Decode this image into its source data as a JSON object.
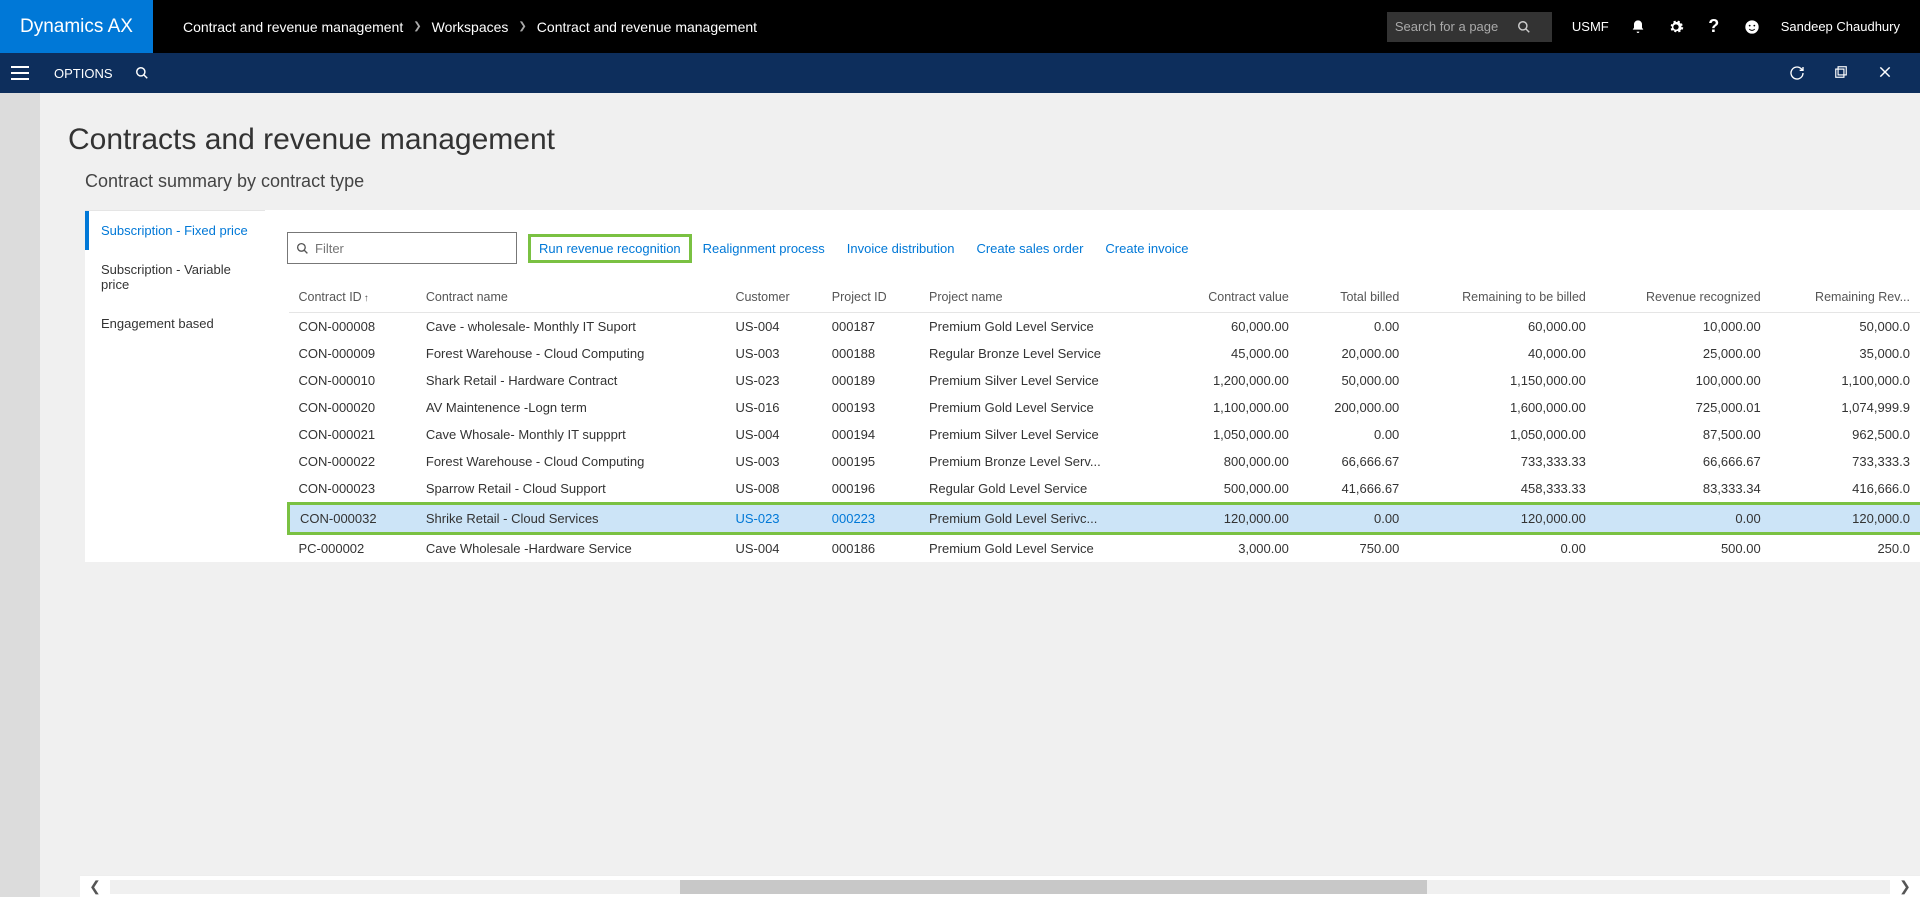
{
  "brand": "Dynamics AX",
  "breadcrumb": [
    "Contract and revenue management",
    "Workspaces",
    "Contract and revenue management"
  ],
  "search_placeholder": "Search for a page",
  "company": "USMF",
  "username": "Sandeep Chaudhury",
  "options_label": "OPTIONS",
  "page_title": "Contracts and revenue management",
  "subtitle": "Contract summary by contract type",
  "side_tabs": [
    {
      "label": "Subscription - Fixed price",
      "active": true
    },
    {
      "label": "Subscription - Variable price",
      "active": false
    },
    {
      "label": "Engagement based",
      "active": false
    }
  ],
  "filter_placeholder": "Filter",
  "actions": {
    "run_revenue": "Run revenue recognition",
    "realignment": "Realignment process",
    "invoice_dist": "Invoice distribution",
    "create_sales": "Create sales order",
    "create_invoice": "Create invoice"
  },
  "columns": [
    "Contract ID",
    "Contract name",
    "Customer",
    "Project ID",
    "Project name",
    "Contract value",
    "Total billed",
    "Remaining to be billed",
    "Revenue recognized",
    "Remaining Rev..."
  ],
  "rows": [
    {
      "id": "CON-000008",
      "name": "Cave - wholesale- Monthly IT Suport",
      "cust": "US-004",
      "proj": "000187",
      "pname": "Premium Gold Level Service",
      "cv": "60,000.00",
      "tb": "0.00",
      "rb": "60,000.00",
      "rr": "10,000.00",
      "rem": "50,000.0",
      "sel": false
    },
    {
      "id": "CON-000009",
      "name": "Forest Warehouse - Cloud Computing",
      "cust": "US-003",
      "proj": "000188",
      "pname": "Regular Bronze Level Service",
      "cv": "45,000.00",
      "tb": "20,000.00",
      "rb": "40,000.00",
      "rr": "25,000.00",
      "rem": "35,000.0",
      "sel": false
    },
    {
      "id": "CON-000010",
      "name": "Shark Retail - Hardware Contract",
      "cust": "US-023",
      "proj": "000189",
      "pname": "Premium Silver Level Service",
      "cv": "1,200,000.00",
      "tb": "50,000.00",
      "rb": "1,150,000.00",
      "rr": "100,000.00",
      "rem": "1,100,000.0",
      "sel": false
    },
    {
      "id": "CON-000020",
      "name": "AV Maintenence -Logn term",
      "cust": "US-016",
      "proj": "000193",
      "pname": "Premium Gold Level Service",
      "cv": "1,100,000.00",
      "tb": "200,000.00",
      "rb": "1,600,000.00",
      "rr": "725,000.01",
      "rem": "1,074,999.9",
      "sel": false
    },
    {
      "id": "CON-000021",
      "name": "Cave Whosale- Monthly IT suppprt",
      "cust": "US-004",
      "proj": "000194",
      "pname": "Premium Silver Level Service",
      "cv": "1,050,000.00",
      "tb": "0.00",
      "rb": "1,050,000.00",
      "rr": "87,500.00",
      "rem": "962,500.0",
      "sel": false
    },
    {
      "id": "CON-000022",
      "name": "Forest Warehouse - Cloud Computing",
      "cust": "US-003",
      "proj": "000195",
      "pname": "Premium Bronze Level Serv...",
      "cv": "800,000.00",
      "tb": "66,666.67",
      "rb": "733,333.33",
      "rr": "66,666.67",
      "rem": "733,333.3",
      "sel": false
    },
    {
      "id": "CON-000023",
      "name": "Sparrow Retail - Cloud Support",
      "cust": "US-008",
      "proj": "000196",
      "pname": "Regular Gold Level Service",
      "cv": "500,000.00",
      "tb": "41,666.67",
      "rb": "458,333.33",
      "rr": "83,333.34",
      "rem": "416,666.0",
      "sel": false
    },
    {
      "id": "CON-000032",
      "name": "Shrike Retail - Cloud Services",
      "cust": "US-023",
      "proj": "000223",
      "pname": "Premium Gold Level Serivc...",
      "cv": "120,000.00",
      "tb": "0.00",
      "rb": "120,000.00",
      "rr": "0.00",
      "rem": "120,000.0",
      "sel": true
    },
    {
      "id": "PC-000002",
      "name": "Cave Wholesale -Hardware Service",
      "cust": "US-004",
      "proj": "000186",
      "pname": "Premium Gold Level Service",
      "cv": "3,000.00",
      "tb": "750.00",
      "rb": "0.00",
      "rr": "500.00",
      "rem": "250.0",
      "sel": false
    }
  ]
}
